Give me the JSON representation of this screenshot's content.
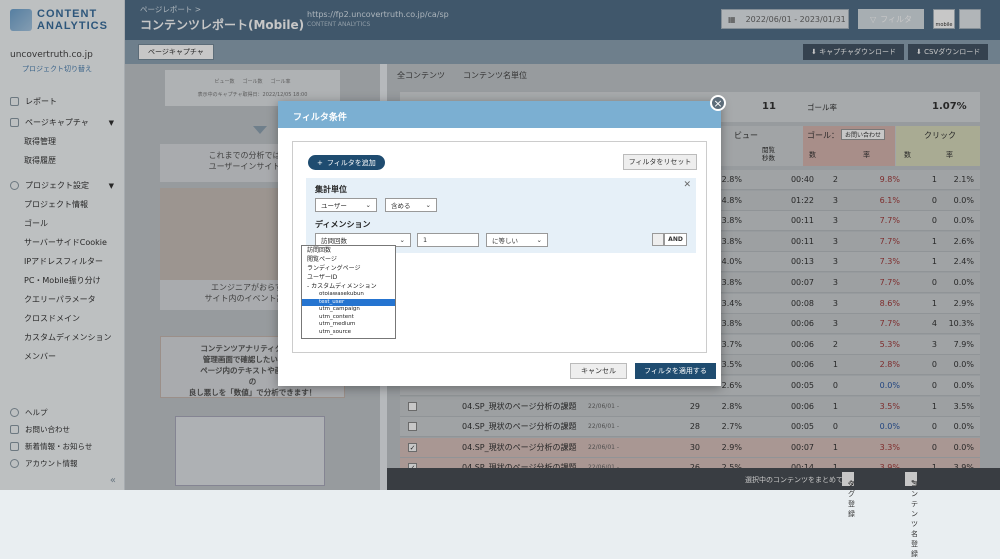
{
  "app": {
    "logo_line1": "CONTENT",
    "logo_line2": "ANALYTICS"
  },
  "project": {
    "domain": "uncovertruth.co.jp",
    "switch_label": "プロジェクト切り替え"
  },
  "sidebar": {
    "report": "レポート",
    "page_capture": {
      "label": "ページキャプチャ",
      "items": [
        "取得管理",
        "取得履歴"
      ]
    },
    "project_settings": {
      "label": "プロジェクト設定",
      "items": [
        "プロジェクト情報",
        "ゴール",
        "サーバーサイドCookie",
        "IPアドレスフィルター",
        "PC・Mobile振り分け",
        "クエリーパラメータ",
        "クロスドメイン",
        "カスタムディメンション",
        "メンバー"
      ]
    },
    "bottom": [
      "ヘルプ",
      "お問い合わせ",
      "新着情報・お知らせ",
      "アカウント情報"
    ]
  },
  "header": {
    "breadcrumb": "ページレポート >",
    "title": "コンテンツレポート(Mobile)",
    "url": "https://fp2.uncovertruth.co.jp/ca/sp",
    "url_sub": "CONTENT ANALYTICS",
    "date_range": "2022/06/01 - 2023/01/31",
    "filter_label": "フィルタ",
    "device_label": "mobile"
  },
  "toolbar": {
    "capture_button": "ページキャプチャ",
    "capture_download": "キャプチャダウンロード",
    "csv_download": "CSVダウンロード"
  },
  "left_panel": {
    "legend": [
      "ビュー数",
      "ゴール数",
      "ゴール率"
    ],
    "capture_date": "表示中のキャプチャ取得日：2022/12/05 18:00",
    "card1": [
      "これまでの分析では発見",
      "ユーザーインサイトを知"
    ],
    "card2": [
      "エンジニアがおらず（t",
      "サイト内のイベント設定が"
    ],
    "card3": [
      "コンテンツアナリティクスなら",
      "管理画面で確認したいURLを",
      "ページ内のテキストや画像（コ",
      "の",
      "良し悪しを「数値」で分析できます！"
    ]
  },
  "right_panel": {
    "tabs": [
      "全コンテンツ",
      "コンテンツ名単位"
    ],
    "summary": {
      "count": "11",
      "goal_rate_label": "ゴール率",
      "goal_rate": "1.07%"
    },
    "col_view": "ビュー",
    "col_goal": "ゴール：",
    "col_goal_select": "お問い合わせ",
    "col_click": "クリック",
    "col_stay": "閲覧\n秒数",
    "col_count": "数",
    "col_rate": "率"
  },
  "table": {
    "rows": [
      {
        "view_rate": "2.8%",
        "time": "00:40",
        "goal_count": "2",
        "goal_rate": "9.8%",
        "click_count": "1",
        "click_rate": "2.1%",
        "goal_color": "red"
      },
      {
        "view_rate": "4.8%",
        "time": "01:22",
        "goal_count": "3",
        "goal_rate": "6.1%",
        "click_count": "0",
        "click_rate": "0.0%",
        "goal_color": "red"
      },
      {
        "view_rate": "3.8%",
        "time": "00:11",
        "goal_count": "3",
        "goal_rate": "7.7%",
        "click_count": "0",
        "click_rate": "0.0%",
        "goal_color": "red"
      },
      {
        "view_rate": "3.8%",
        "time": "00:11",
        "goal_count": "3",
        "goal_rate": "7.7%",
        "click_count": "1",
        "click_rate": "2.6%",
        "goal_color": "red"
      },
      {
        "view_rate": "4.0%",
        "time": "00:13",
        "goal_count": "3",
        "goal_rate": "7.3%",
        "click_count": "1",
        "click_rate": "2.4%",
        "goal_color": "red"
      },
      {
        "view_rate": "3.8%",
        "time": "00:07",
        "goal_count": "3",
        "goal_rate": "7.7%",
        "click_count": "0",
        "click_rate": "0.0%",
        "goal_color": "red"
      },
      {
        "view_rate": "3.4%",
        "time": "00:08",
        "goal_count": "3",
        "goal_rate": "8.6%",
        "click_count": "1",
        "click_rate": "2.9%",
        "goal_color": "red"
      },
      {
        "view_rate": "3.8%",
        "time": "00:06",
        "goal_count": "3",
        "goal_rate": "7.7%",
        "click_count": "4",
        "click_rate": "10.3%",
        "goal_color": "red"
      },
      {
        "view_rate": "3.7%",
        "time": "00:06",
        "goal_count": "2",
        "goal_rate": "5.3%",
        "click_count": "3",
        "click_rate": "7.9%",
        "goal_color": "red"
      },
      {
        "view_rate": "3.5%",
        "time": "00:06",
        "goal_count": "1",
        "goal_rate": "2.8%",
        "click_count": "0",
        "click_rate": "0.0%",
        "goal_color": "red"
      },
      {
        "view_rate": "2.6%",
        "time": "00:05",
        "goal_count": "0",
        "goal_rate": "0.0%",
        "click_count": "0",
        "click_rate": "0.0%",
        "goal_color": "blue"
      },
      {
        "title": "04.SP_現状のページ分析の課題",
        "date": "22/06/01 -",
        "views": "29",
        "view_rate": "2.8%",
        "time": "00:06",
        "goal_count": "1",
        "goal_rate": "3.5%",
        "click_count": "1",
        "click_rate": "3.5%",
        "goal_color": "red"
      },
      {
        "title": "04.SP_現状のページ分析の課題",
        "date": "22/06/01 -",
        "views": "28",
        "view_rate": "2.7%",
        "time": "00:05",
        "goal_count": "0",
        "goal_rate": "0.0%",
        "click_count": "0",
        "click_rate": "0.0%",
        "goal_color": "blue"
      },
      {
        "title": "04.SP_現状のページ分析の課題",
        "date": "22/06/01 -",
        "views": "30",
        "view_rate": "2.9%",
        "time": "00:07",
        "goal_count": "1",
        "goal_rate": "3.3%",
        "click_count": "0",
        "click_rate": "0.0%",
        "goal_color": "red"
      },
      {
        "title": "04.SP_現状のページ分析の課題",
        "date": "22/06/01 -",
        "views": "26",
        "view_rate": "2.5%",
        "time": "00:14",
        "goal_count": "1",
        "goal_rate": "3.9%",
        "click_count": "1",
        "click_rate": "3.9%",
        "goal_color": "red"
      }
    ]
  },
  "footer": {
    "text": "選択中のコンテンツをまとめて",
    "tag_button": "タグ登録",
    "content_button": "コンテンツ名登録"
  },
  "modal": {
    "title": "フィルタ条件",
    "add_filter": "フィルタを追加",
    "reset_filter": "フィルタをリセット",
    "unit_label": "集計単位",
    "unit_value": "ユーザー",
    "unit_op": "含める",
    "dimension_label": "ディメンション",
    "dimension_value": "訪問回数",
    "dimension_input": "1",
    "dimension_op": "に等しい",
    "and_label": "AND",
    "cancel": "キャンセル",
    "apply": "フィルタを適用する",
    "dropdown_items": [
      "訪問回数",
      "閲覧ページ",
      "ランディングページ",
      "ユーザーID",
      "- カスタムディメンション"
    ],
    "dropdown_sub": [
      "otoiawasekubun",
      "test_user",
      "utm_campaign",
      "utm_content",
      "utm_medium",
      "utm_source"
    ],
    "dropdown_selected": "test_user"
  }
}
